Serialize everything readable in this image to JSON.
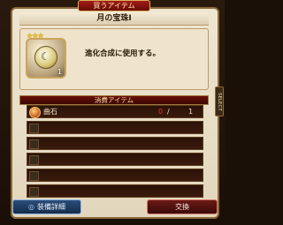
{
  "header": {
    "title": "買うアイテム"
  },
  "item": {
    "name": "月の宝珠Ⅰ",
    "stars_glyphs": "★★★",
    "count": "1",
    "description": "進化合成に使用する。"
  },
  "side_tab": {
    "label": "SELECT"
  },
  "consume": {
    "title": "消費アイテム",
    "rows": [
      {
        "name": "曲石",
        "have": "0",
        "slash": "/",
        "need": "1",
        "filled": true
      },
      {
        "name": "",
        "have": "",
        "slash": "",
        "need": "",
        "filled": false
      },
      {
        "name": "",
        "have": "",
        "slash": "",
        "need": "",
        "filled": false
      },
      {
        "name": "",
        "have": "",
        "slash": "",
        "need": "",
        "filled": false
      },
      {
        "name": "",
        "have": "",
        "slash": "",
        "need": "",
        "filled": false
      },
      {
        "name": "",
        "have": "",
        "slash": "",
        "need": "",
        "filled": false
      }
    ]
  },
  "buttons": {
    "details": "装備詳細",
    "exchange": "交換"
  },
  "colors": {
    "accent_red": "#a31a14",
    "accent_blue": "#2a4d7a",
    "gold": "#caa55d"
  },
  "icons": {
    "item": "moon-orb-icon",
    "consume_item": "magatama-icon",
    "details": "search-icon"
  }
}
